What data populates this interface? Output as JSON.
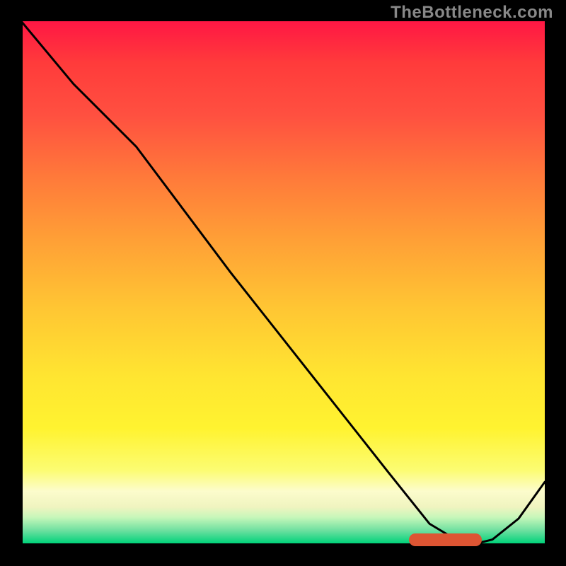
{
  "watermark": "TheBottleneck.com",
  "chart_data": {
    "type": "line",
    "title": "",
    "xlabel": "",
    "ylabel": "",
    "xlim": [
      0,
      100
    ],
    "ylim": [
      0,
      100
    ],
    "gradient_stops": [
      {
        "pos": 0,
        "color": "#ff1744"
      },
      {
        "pos": 18,
        "color": "#ff5040"
      },
      {
        "pos": 42,
        "color": "#ffa036"
      },
      {
        "pos": 68,
        "color": "#ffe531"
      },
      {
        "pos": 86,
        "color": "#fcfc72"
      },
      {
        "pos": 93,
        "color": "#f0f4c0"
      },
      {
        "pos": 100,
        "color": "#00d27a"
      }
    ],
    "series": [
      {
        "name": "bottleneck-curve",
        "x": [
          0,
          10,
          22,
          40,
          55,
          70,
          78,
          83,
          86,
          90,
          95,
          100
        ],
        "y": [
          100,
          88,
          76,
          52,
          33,
          14,
          4,
          1,
          0,
          1,
          5,
          12
        ]
      }
    ],
    "optimal_marker": {
      "x_start": 74,
      "x_end": 88,
      "y": 0.5
    }
  }
}
